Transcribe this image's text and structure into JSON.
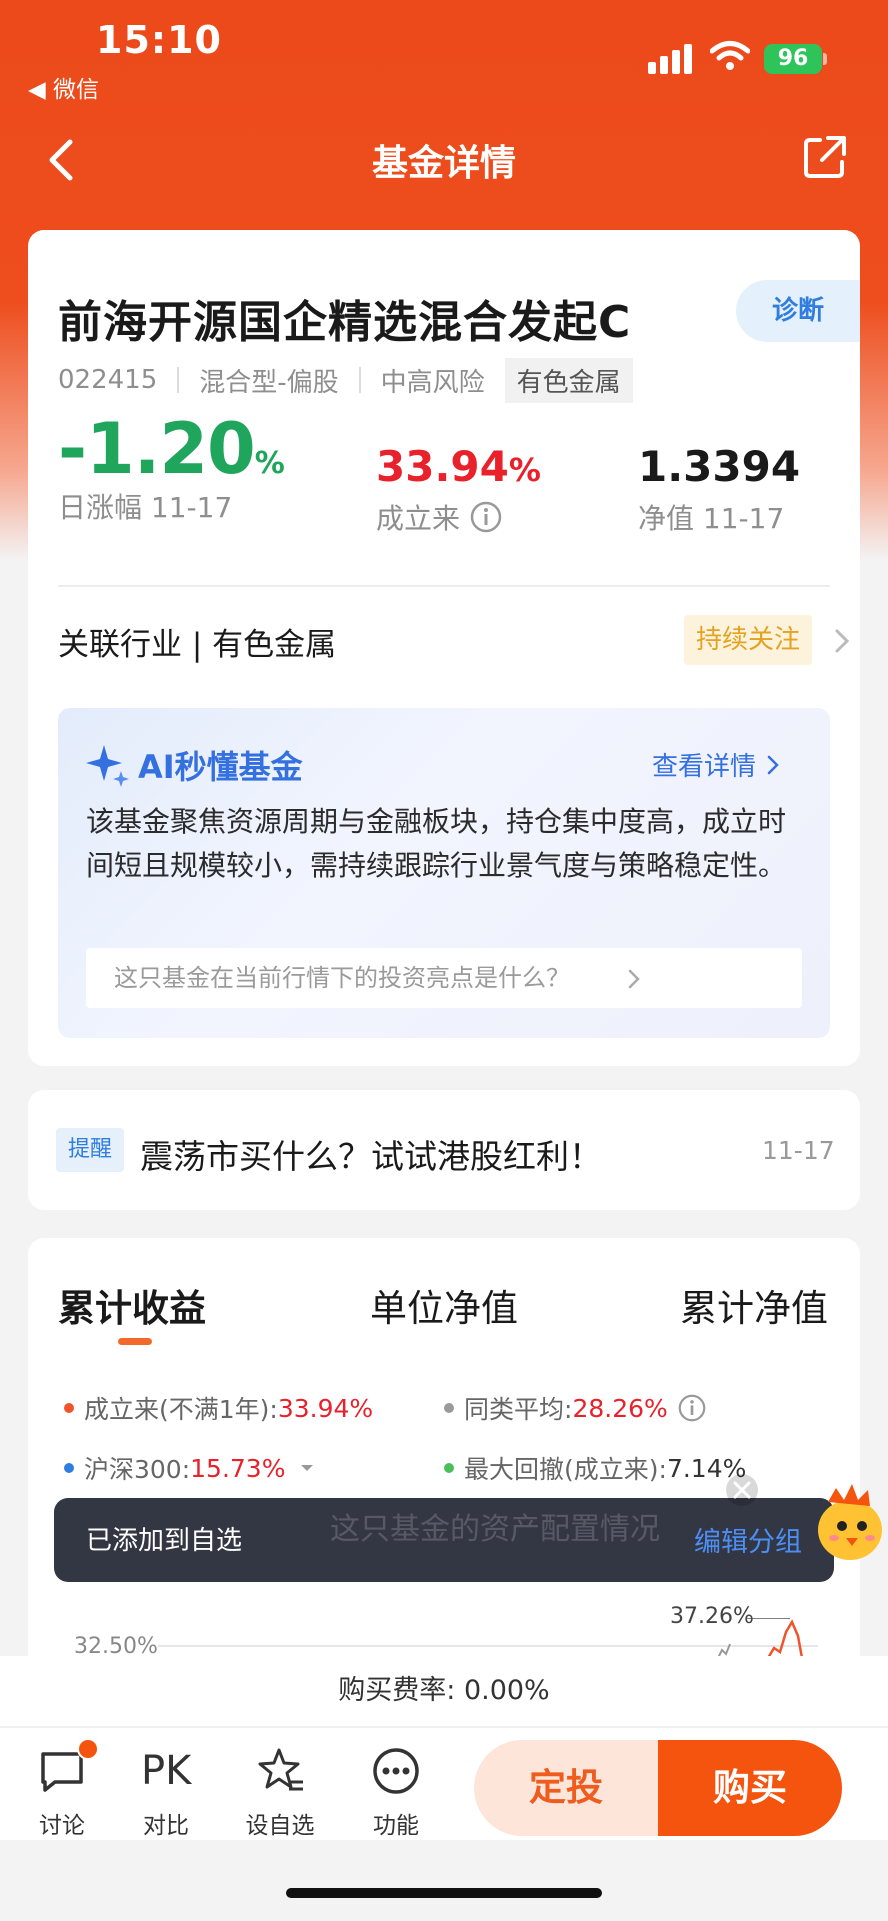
{
  "status_bar": {
    "time": "15:10",
    "back_app": "◀ 微信",
    "battery": "96"
  },
  "nav": {
    "title": "基金详情"
  },
  "fund": {
    "name": "前海开源国企精选混合发起C",
    "diagnose_label": "诊断",
    "code": "022415",
    "type": "混合型-偏股",
    "risk": "中高风险",
    "sector_tag": "有色金属",
    "daily_change": "-1.20",
    "daily_change_unit": "%",
    "daily_change_label": "日涨幅 11-17",
    "since_inception": "33.94",
    "since_inception_unit": "%",
    "since_inception_label": "成立来",
    "nav_value": "1.3394",
    "nav_label": "净值 11-17",
    "industry": "关联行业 | 有色金属",
    "follow_label": "持续关注"
  },
  "ai": {
    "title": "AI秒懂基金",
    "link": "查看详情",
    "summary": "该基金聚焦资源周期与金融板块，持仓集中度高，成立时间短且规模较小，需持续跟踪行业景气度与策略稳定性。",
    "question": "这只基金在当前行情下的投资亮点是什么？"
  },
  "tip": {
    "badge": "提醒",
    "text": "震荡市买什么？试试港股红利！",
    "date": "11-17"
  },
  "chart": {
    "tabs": [
      "累计收益",
      "单位净值",
      "累计净值"
    ],
    "legend": [
      {
        "label": "成立来(不满1年):",
        "value": "33.94%",
        "color": "#f0542a"
      },
      {
        "label": "同类平均:",
        "value": "28.26%",
        "color": "#9a9a9a"
      },
      {
        "label": "沪深300:",
        "value": "15.73%",
        "color": "#2f7de0"
      },
      {
        "label": "最大回撤(成立来):",
        "value": "7.14%",
        "color": "#4bc05a"
      }
    ],
    "y_tick": "32.50%",
    "peak_label": "37.26%"
  },
  "toast": {
    "text": "已添加到自选",
    "link": "编辑分组",
    "ghost": "这只基金的资产配置情况"
  },
  "footer": {
    "fee": "购买费率: 0.00%",
    "items": [
      {
        "label": "讨论",
        "icon": "chat-icon"
      },
      {
        "label": "对比",
        "icon": "pk-icon",
        "glyph": "PK"
      },
      {
        "label": "设自选",
        "icon": "star-list-icon"
      },
      {
        "label": "功能",
        "icon": "more-icon"
      }
    ],
    "dingtou": "定投",
    "buy": "购买"
  }
}
